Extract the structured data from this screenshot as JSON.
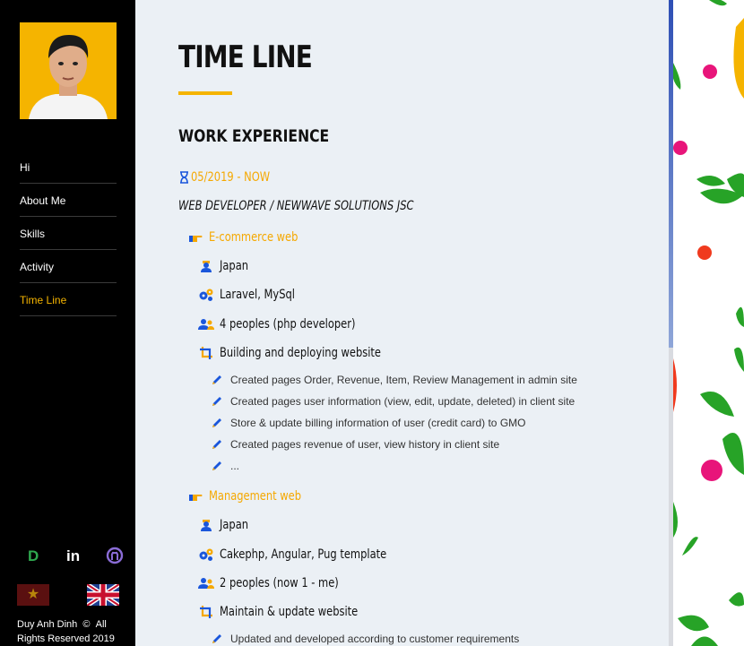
{
  "sidebar": {
    "nav": [
      {
        "label": "Hi"
      },
      {
        "label": "About Me"
      },
      {
        "label": "Skills"
      },
      {
        "label": "Activity"
      },
      {
        "label": "Time Line",
        "active": true
      }
    ],
    "socials": [
      "dribbble-icon",
      "linkedin-icon",
      "github-icon"
    ],
    "languages": [
      "vietnam-flag",
      "uk-flag"
    ],
    "footer": {
      "name": "Duy Anh Dinh",
      "copyright_symbol": "©",
      "rights": "All Rights Reserved 2019"
    }
  },
  "main": {
    "title": "TIME LINE",
    "section": "WORK EXPERIENCE",
    "date": "05/2019 - NOW",
    "role": "WEB DEVELOPER / NEWWAVE SOLUTIONS JSC",
    "projects": [
      {
        "name": "E-commerce web",
        "location": "Japan",
        "tech": "Laravel, MySql",
        "team": "4 peoples (php developer)",
        "scope": "Building and deploying website",
        "tasks": [
          "Created pages Order, Revenue, Item, Review Management in admin site",
          "Created pages user information (view, edit, update, deleted) in client site",
          "Store & update billing information of user (credit card) to GMO",
          "Created pages revenue of user, view history in client site",
          "..."
        ]
      },
      {
        "name": "Management web",
        "location": "Japan",
        "tech": "Cakephp, Angular, Pug template",
        "team": "2 peoples (now 1 - me)",
        "scope": "Maintain & update website",
        "tasks": [
          "Updated and developed according to customer requirements"
        ]
      }
    ]
  },
  "colors": {
    "accent": "#f5b400",
    "icon_blue": "#1a56db",
    "sidebar_bg": "#000000",
    "main_bg": "#ebf0f5"
  }
}
